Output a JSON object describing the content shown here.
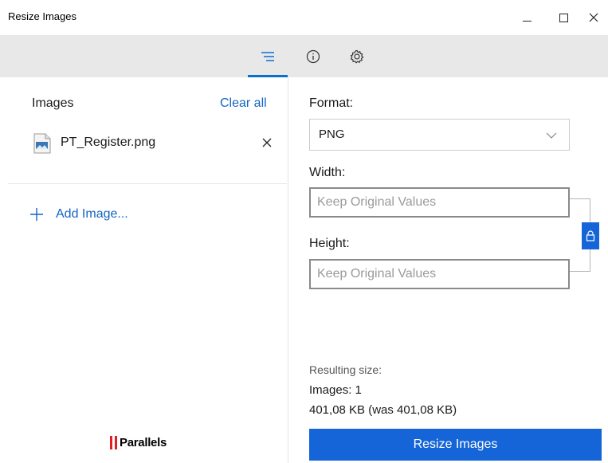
{
  "window": {
    "title": "Resize Images"
  },
  "toolbar": {
    "tabs": [
      {
        "icon": "list-icon",
        "active": true
      },
      {
        "icon": "info-icon",
        "active": false
      },
      {
        "icon": "gear-icon",
        "active": false
      }
    ]
  },
  "left_pane": {
    "title": "Images",
    "clear_all_label": "Clear all",
    "files": [
      {
        "name": "PT_Register.png",
        "icon": "image-file-icon"
      }
    ],
    "add_image_label": "Add Image...",
    "brand": "Parallels"
  },
  "settings": {
    "format_label": "Format:",
    "format_value": "PNG",
    "width_label": "Width:",
    "width_placeholder": "Keep Original Values",
    "height_label": "Height:",
    "height_placeholder": "Keep Original Values",
    "aspect_lock": "lock-icon"
  },
  "result": {
    "title": "Resulting size:",
    "images_count": "Images: 1",
    "size_text": "401,08 KB (was 401,08 KB)"
  },
  "actions": {
    "resize_label": "Resize Images"
  },
  "colors": {
    "accent": "#1565d8",
    "link": "#1565c0",
    "toolbar_bg": "#e8e8e8",
    "brand_red": "#e31e24"
  }
}
